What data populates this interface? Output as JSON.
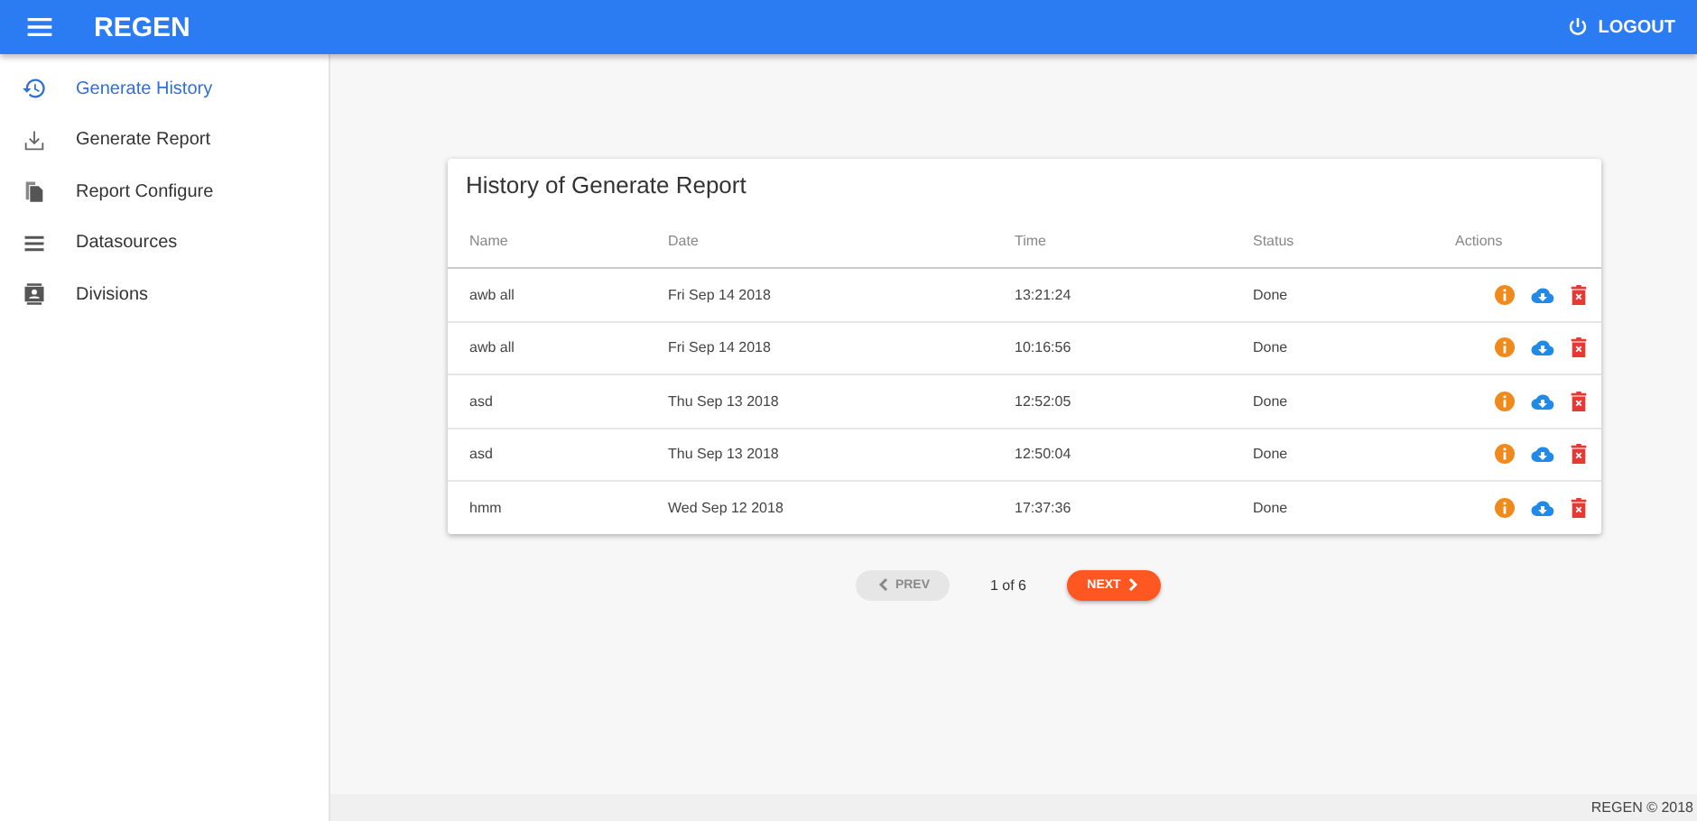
{
  "app_bar": {
    "title": "REGEN",
    "logout_label": "LOGOUT"
  },
  "sidebar": {
    "items": [
      {
        "label": "Generate History",
        "kind": "history",
        "selected": true
      },
      {
        "label": "Generate Report",
        "kind": "download",
        "selected": false
      },
      {
        "label": "Report Configure",
        "kind": "file",
        "selected": false
      },
      {
        "label": "Datasources",
        "kind": "list",
        "selected": false
      },
      {
        "label": "Divisions",
        "kind": "contact",
        "selected": false
      }
    ]
  },
  "card": {
    "title": "History of Generate Report",
    "columns": [
      "Name",
      "Date",
      "Time",
      "Status",
      "Actions"
    ],
    "rows": [
      {
        "name": "awb all",
        "date": "Fri Sep 14 2018",
        "time": "13:21:24",
        "status": "Done"
      },
      {
        "name": "awb all",
        "date": "Fri Sep 14 2018",
        "time": "10:16:56",
        "status": "Done"
      },
      {
        "name": "asd",
        "date": "Thu Sep 13 2018",
        "time": "12:52:05",
        "status": "Done"
      },
      {
        "name": "asd",
        "date": "Thu Sep 13 2018",
        "time": "12:50:04",
        "status": "Done"
      },
      {
        "name": "hmm",
        "date": "Wed Sep 12 2018",
        "time": "17:37:36",
        "status": "Done"
      }
    ]
  },
  "pagination": {
    "prev": {
      "label": "PREV",
      "disabled": true
    },
    "page": "1 of 6",
    "next": {
      "label": "NEXT",
      "disabled": false
    }
  },
  "footer": "REGEN © 2018"
}
